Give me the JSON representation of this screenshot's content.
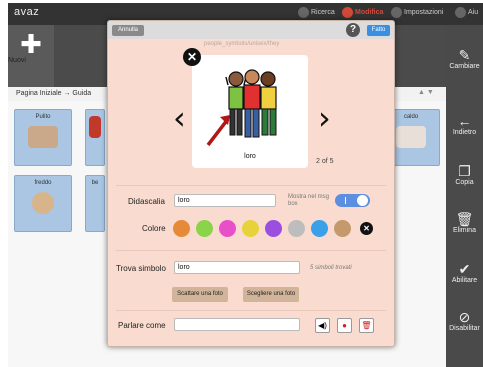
{
  "app": {
    "logo": "avaz",
    "top_menu": [
      {
        "label": "Ricerca",
        "active": false
      },
      {
        "label": "Modifica",
        "active": true
      },
      {
        "label": "Impostazioni",
        "active": false
      },
      {
        "label": "Aiu",
        "active": false
      }
    ],
    "new_label": "Nuovi",
    "breadcrumb": "Pagina Iniziale → Guida",
    "tiles": [
      {
        "label": "Pulito"
      },
      {
        "label": "caldo"
      },
      {
        "label": "freddo"
      },
      {
        "label": "be"
      }
    ],
    "right_bar": [
      {
        "label": "Cambiare",
        "icon": "edit-icon"
      },
      {
        "label": "Indietro",
        "icon": "back-arrow-icon"
      },
      {
        "label": "Copia",
        "icon": "copy-icon"
      },
      {
        "label": "Elimina",
        "icon": "trash-icon"
      },
      {
        "label": "Abilitare",
        "icon": "check-icon"
      },
      {
        "label": "Disabilitar",
        "icon": "disable-icon"
      }
    ]
  },
  "modal": {
    "cancel_label": "Annulla",
    "done_label": "Fatto",
    "source_path": "people_symbols/unisex/they",
    "symbol_label": "loro",
    "symbol_count": "2 of 5",
    "caption_label": "Didascalia",
    "caption_value": "loro",
    "show_caption_note": "Mostra nel msg box",
    "color_label": "Colore",
    "colors": [
      "#e68a3a",
      "#8ad44a",
      "#e84fc9",
      "#e8d23a",
      "#9b4fe0",
      "#bdbdbd",
      "#3aa0e8",
      "#c49a6c"
    ],
    "find_symbol_label": "Trova simbolo",
    "find_symbol_value": "loro",
    "symbols_found": "5 simboli trovati",
    "take_photo_label": "Scattare una foto",
    "choose_photo_label": "Scegliere una foto",
    "speak_as_label": "Parlare come",
    "speak_as_value": ""
  }
}
